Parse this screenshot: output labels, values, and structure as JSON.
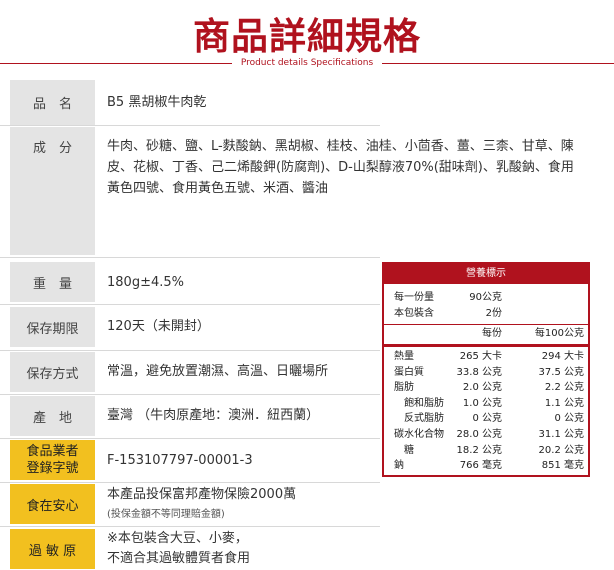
{
  "header": {
    "title": "商品詳細規格",
    "subtitle": "Product details Specifications"
  },
  "specs": {
    "name_label": "品　名",
    "name_value": "B5 黑胡椒牛肉乾",
    "ingredients_label": "成　分",
    "ingredients_line1": "牛肉、砂糖、鹽、L-麩酸鈉、黑胡椒、桂枝、油桂、小茴香、薑、三柰、甘草、陳",
    "ingredients_line2": "皮、花椒、丁香、己二烯酸鉀(防腐劑)、D-山梨醇液70%(甜味劑)、乳酸鈉、食用",
    "ingredients_line3": "黃色四號、食用黃色五號、米酒、醬油",
    "weight_label": "重　量",
    "weight_value": "180g±4.5%",
    "shelf_label": "保存期限",
    "shelf_value": "120天（未開封）",
    "storage_label": "保存方式",
    "storage_value": "常溫，避免放置潮濕、高溫、日曬場所",
    "origin_label": "產　地",
    "origin_value": "臺灣 （牛肉原產地：澳洲．紐西蘭）",
    "reg_label_1": "食品業者",
    "reg_label_2": "登錄字號",
    "reg_value": "F-153107797-00001-3",
    "safety_label": "食在安心",
    "safety_value": "本產品投保富邦產物保險2000萬",
    "safety_note": "(投保金額不等同理賠金額)",
    "allergen_label": "過 敏 原",
    "allergen_line1": "※本包裝含大豆、小麥，",
    "allergen_line2": "不適合其過敏體質者食用"
  },
  "nutrition": {
    "title": "營養標示",
    "serving_size_label": "每一份量",
    "serving_size_value": "90公克",
    "servings_label": "本包裝含",
    "servings_value": "2份",
    "col_per_serving": "每份",
    "col_per_100g": "每100公克",
    "rows": [
      {
        "name": "熱量",
        "per": "265 大卡",
        "per100": "294 大卡"
      },
      {
        "name": "蛋白質",
        "per": "33.8 公克",
        "per100": "37.5 公克"
      },
      {
        "name": "脂肪",
        "per": "2.0 公克",
        "per100": "2.2 公克"
      },
      {
        "name": "　飽和脂肪",
        "per": "1.0 公克",
        "per100": "1.1 公克"
      },
      {
        "name": "　反式脂肪",
        "per": "0 公克",
        "per100": "0 公克"
      },
      {
        "name": "碳水化合物",
        "per": "28.0 公克",
        "per100": "31.1 公克"
      },
      {
        "name": "　糖",
        "per": "18.2 公克",
        "per100": "20.2 公克"
      },
      {
        "name": "鈉",
        "per": "766 毫克",
        "per100": "851 毫克"
      }
    ]
  }
}
